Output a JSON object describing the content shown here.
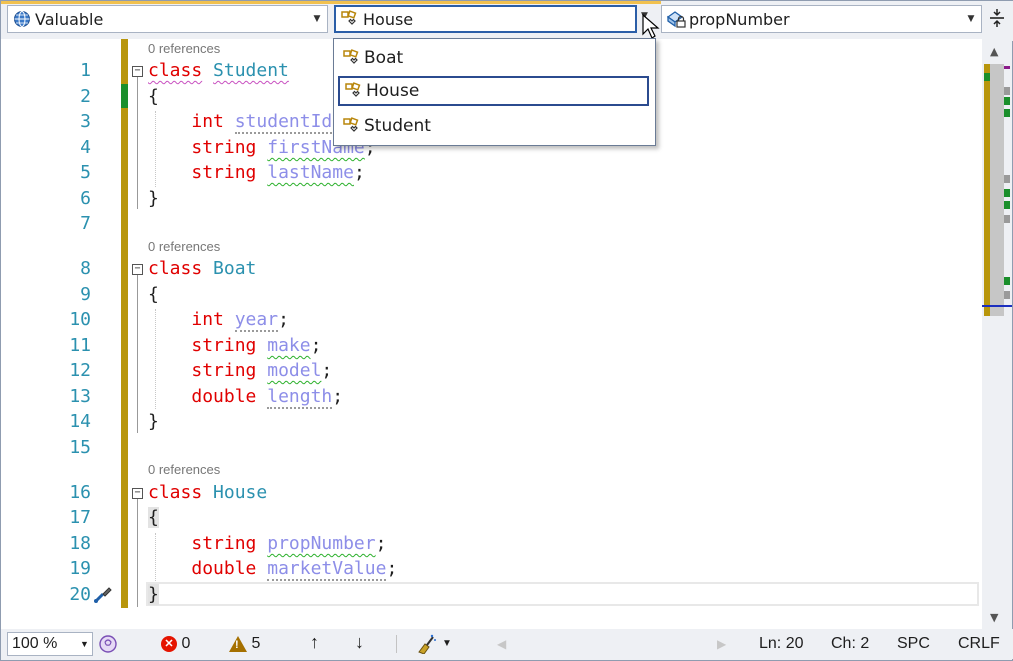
{
  "navbar": {
    "project": "Valuable",
    "type": "House",
    "member": "propNumber"
  },
  "type_dropdown": {
    "items": [
      {
        "label": "Boat",
        "selected": false
      },
      {
        "label": "House",
        "selected": true
      },
      {
        "label": "Student",
        "selected": false
      }
    ]
  },
  "codelens": {
    "student_refs": "0 references",
    "boat_refs": "0 references",
    "house_refs": "0 references"
  },
  "lines": {
    "n1": "1",
    "n2": "2",
    "n3": "3",
    "n4": "4",
    "n5": "5",
    "n6": "6",
    "n7": "7",
    "n8": "8",
    "n9": "9",
    "n10": "10",
    "n11": "11",
    "n12": "12",
    "n13": "13",
    "n14": "14",
    "n15": "15",
    "n16": "16",
    "n17": "17",
    "n18": "18",
    "n19": "19",
    "n20": "20"
  },
  "code": {
    "kw_class": "class",
    "kw_int": "int",
    "kw_string": "string",
    "kw_double": "double",
    "open_brace": "{",
    "close_brace": "}",
    "semicolon": ";",
    "student": "Student",
    "boat": "Boat",
    "house": "House",
    "studentId": "studentId",
    "firstName": "firstName",
    "lastName": "lastName",
    "year": "year",
    "make": "make",
    "model": "model",
    "length": "length",
    "propNumber": "propNumber",
    "marketValue": "marketValue"
  },
  "status": {
    "zoom": "100 %",
    "errors": "0",
    "warnings": "5",
    "line": "Ln: 20",
    "col": "Ch: 2",
    "whitespace": "SPC",
    "line_ending": "CRLF"
  },
  "colors": {
    "keyword": "#e00000",
    "type": "#2b91af",
    "field": "#8d8ee8",
    "change_bar": "#b8960c",
    "saved_change": "#1a8f2b"
  }
}
